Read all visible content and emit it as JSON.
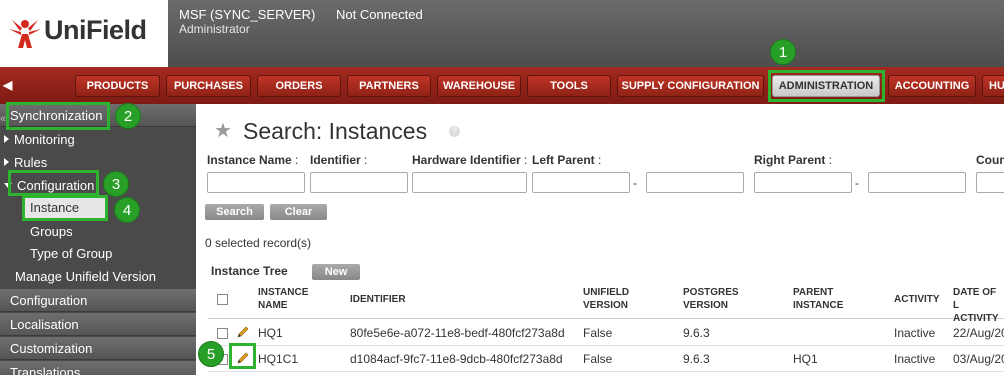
{
  "header": {
    "logo_text": "UniField",
    "db_name": "MSF (SYNC_SERVER)",
    "connection_status": "Not Connected",
    "user": "Administrator"
  },
  "menu": {
    "collapse_icon": "left-arrow-icon",
    "items": [
      "PRODUCTS",
      "PURCHASES",
      "ORDERS",
      "PARTNERS",
      "WAREHOUSE",
      "TOOLS",
      "SUPPLY CONFIGURATION",
      "ADMINISTRATION",
      "ACCOUNTING",
      "HU"
    ],
    "active": "ADMINISTRATION"
  },
  "sidebar": {
    "section_sync": "Synchronization",
    "items": [
      "Monitoring",
      "Rules",
      "Configuration"
    ],
    "sub_items": [
      "Instance",
      "Groups",
      "Type of Group"
    ],
    "manage": "Manage Unifield Version",
    "sections": [
      "Configuration",
      "Localisation",
      "Customization",
      "Translations"
    ]
  },
  "main": {
    "title": "Search: Instances",
    "help_icon": "?",
    "filters": {
      "instance_name": "Instance Name",
      "identifier": "Identifier",
      "hardware_identifier": "Hardware Identifier",
      "left_parent": "Left Parent",
      "right_parent": "Right Parent",
      "country": "Coun",
      "colon": ":",
      "dash": "-"
    },
    "search_button": "Search",
    "clear_button": "Clear",
    "selected_count": "0 selected record(s)",
    "tree_title": "Instance Tree",
    "new_button": "New"
  },
  "table": {
    "headers": {
      "instance": [
        "INSTANCE",
        "NAME"
      ],
      "identifier": [
        "IDENTIFIER"
      ],
      "unifield": [
        "UNIFIELD",
        "VERSION"
      ],
      "postgres": [
        "POSTGRES",
        "VERSION"
      ],
      "parent": [
        "PARENT",
        "INSTANCE"
      ],
      "activity": [
        "ACTIVITY"
      ],
      "date": [
        "DATE OF L",
        "ACTIVITY"
      ]
    },
    "rows": [
      {
        "name": "HQ1",
        "identifier": "80fe5e6e-a072-11e8-bedf-480fcf273a8d",
        "unifield": "False",
        "postgres": "9.6.3",
        "parent": "",
        "activity": "Inactive",
        "date": "22/Aug/20"
      },
      {
        "name": "HQ1C1",
        "identifier": "d1084acf-9fc7-11e8-9dcb-480fcf273a8d",
        "unifield": "False",
        "postgres": "9.6.3",
        "parent": "HQ1",
        "activity": "Inactive",
        "date": "03/Aug/20"
      }
    ]
  },
  "callouts": [
    "1",
    "2",
    "3",
    "4",
    "5"
  ],
  "colors": {
    "menu_red": "#a42a1f",
    "callout_green": "#28a028",
    "highlight_green": "#2db32d"
  }
}
